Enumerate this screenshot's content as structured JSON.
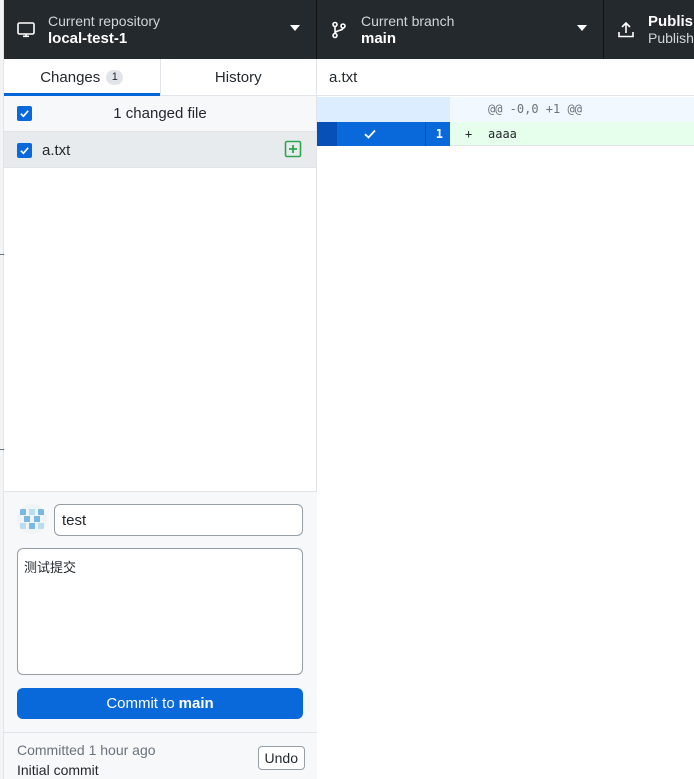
{
  "toolbar": {
    "repository": {
      "label": "Current repository",
      "value": "local-test-1",
      "icon": "desktop-icon"
    },
    "branch": {
      "label": "Current branch",
      "value": "main",
      "icon": "git-branch-icon"
    },
    "publish": {
      "label": "Publis",
      "sublabel": "Publish",
      "icon": "upload-icon"
    }
  },
  "sidebar": {
    "tabs": [
      {
        "label": "Changes",
        "count": "1",
        "selected": true
      },
      {
        "label": "History",
        "selected": false
      }
    ],
    "changes_header": "1 changed file",
    "files": [
      {
        "name": "a.txt",
        "status": "added",
        "checked": true
      }
    ]
  },
  "commit": {
    "summary": "test",
    "description": "测试提交",
    "button_prefix": "Commit to",
    "button_branch": "main"
  },
  "last_commit": {
    "meta": "Committed 1 hour ago",
    "summary": "Initial commit",
    "undo_label": "Undo"
  },
  "diff": {
    "file_name": "a.txt",
    "hunk_header": "@@ -0,0 +1 @@",
    "lines": [
      {
        "new_line_no": "1",
        "marker": "+",
        "text": "aaaa",
        "type": "added",
        "selected": true
      }
    ]
  },
  "colors": {
    "toolbar_bg": "#24292e",
    "accent_blue": "#0969da",
    "added_green": "#2ea44f",
    "added_bg": "#e6ffed",
    "hunk_bg": "#f1f8ff"
  }
}
